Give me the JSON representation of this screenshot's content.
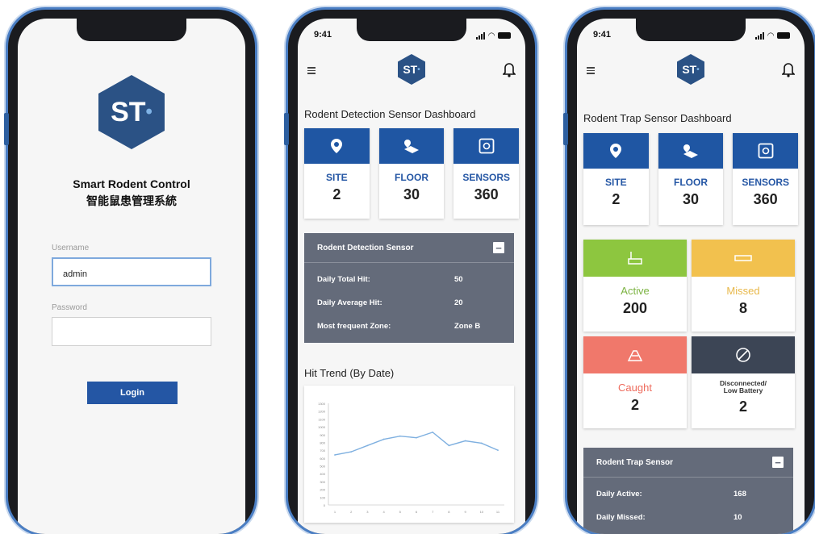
{
  "login": {
    "title_en": "Smart Rodent Control",
    "title_zh": "智能鼠患管理系統",
    "logo_text": "ST",
    "username_label": "Username",
    "username_value": "admin",
    "password_label": "Password",
    "password_value": "",
    "login_button": "Login"
  },
  "status_bar": {
    "time": "9:41"
  },
  "detection": {
    "title": "Rodent Detection Sensor Dashboard",
    "stats": [
      {
        "label": "SITE",
        "value": "2",
        "icon": "location-pin-icon"
      },
      {
        "label": "FLOOR",
        "value": "30",
        "icon": "floor-map-icon"
      },
      {
        "label": "SENSORS",
        "value": "360",
        "icon": "sensor-icon"
      }
    ],
    "panel": {
      "title": "Rodent Detection Sensor",
      "rows": [
        {
          "key": "Daily Total Hit:",
          "value": "50"
        },
        {
          "key": "Daily Average Hit:",
          "value": "20"
        },
        {
          "key": "Most frequent Zone:",
          "value": "Zone B"
        }
      ]
    },
    "trend_title": "Hit Trend (By Date)"
  },
  "trap": {
    "title": "Rodent Trap Sensor Dashboard",
    "stats": [
      {
        "label": "SITE",
        "value": "2",
        "icon": "location-pin-icon"
      },
      {
        "label": "FLOOR",
        "value": "30",
        "icon": "floor-map-icon"
      },
      {
        "label": "SENSORS",
        "value": "360",
        "icon": "sensor-icon"
      }
    ],
    "status": [
      {
        "label": "Active",
        "value": "200",
        "color": "#8dc63f",
        "text_color": "#7cb342"
      },
      {
        "label": "Missed",
        "value": "8",
        "color": "#f2c14e",
        "text_color": "#e8b84a"
      },
      {
        "label": "Caught",
        "value": "2",
        "color": "#f0786b",
        "text_color": "#ee6b5d"
      },
      {
        "label_line1": "Disconnected/",
        "label_line2": "Low Battery",
        "value": "2",
        "color": "#3c4555",
        "text_color": "#333333"
      }
    ],
    "panel": {
      "title": "Rodent Trap Sensor",
      "rows": [
        {
          "key": "Daily Active:",
          "value": "168"
        },
        {
          "key": "Daily Missed:",
          "value": "10"
        }
      ]
    }
  },
  "colors": {
    "primary": "#1f56a3",
    "panel": "#646b7a",
    "frame": "#4a7ec4"
  },
  "chart_data": {
    "type": "line",
    "x": [
      "1",
      "2",
      "3",
      "4",
      "5",
      "6",
      "7",
      "8",
      "9",
      "10",
      "11"
    ],
    "values": [
      640,
      680,
      760,
      840,
      880,
      860,
      930,
      760,
      820,
      790,
      700
    ],
    "ylim": [
      0,
      1300
    ],
    "yticks": [
      "0",
      "100",
      "200",
      "300",
      "400",
      "500",
      "600",
      "700",
      "800",
      "900",
      "1000",
      "1100",
      "1200",
      "1300"
    ],
    "color": "#7fb0e0"
  }
}
